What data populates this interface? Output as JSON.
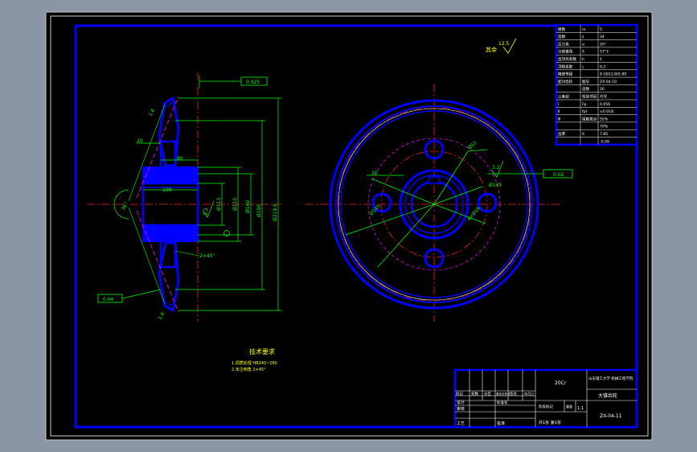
{
  "drawing": {
    "colors": {
      "window_bg": "#8a96a4",
      "paper": "#000000",
      "border": "#0000ff",
      "dimension": "#00ff00",
      "centerline": "#ff2020",
      "hidden": "#ff00ff",
      "text": "#ffffff",
      "note": "#ffff00"
    },
    "section_view": {
      "dims": {
        "bore": "100",
        "hub_len": "80",
        "left_20": "20",
        "tol_top": "0.025",
        "tol_bot": "0.04",
        "dia_113": "Ø113",
        "dia_x": "Ø110",
        "dia_y": "Ø140",
        "dia_z": "Ø190",
        "dia_big": "Ø218.6",
        "chamfer": "2×45°",
        "angle": "36°",
        "tip": "1.6",
        "ra": "3.2"
      }
    },
    "front_view": {
      "dims": {
        "pcd": "Ø145",
        "bolt": "Ø12",
        "bolt_pcd": "Ø145",
        "hole_4": "4×Ø16",
        "ra": "3.2",
        "tol": "0.02",
        "r": "20"
      }
    },
    "roughness_note": {
      "label": "其余",
      "value": "12.5"
    },
    "tech_req": {
      "title": "技术要求",
      "lines": [
        "1.调质处理 HB240~280",
        "2.未注倒角 2×45°"
      ]
    },
    "param_table": {
      "rows": [
        [
          "模数",
          "m",
          "5"
        ],
        [
          "齿数",
          "z",
          "34"
        ],
        [
          "压力角",
          "α",
          "20°"
        ],
        [
          "分度锥角",
          "δ",
          "57°1'"
        ],
        [
          "齿顶高系数",
          "h",
          "1"
        ],
        [
          "顶隙系数",
          "c",
          "0.2"
        ],
        [
          "精度等级",
          "",
          "8 GB11365-89"
        ],
        [
          "配对齿轮",
          "图号",
          "ZX-04-10"
        ],
        [
          "",
          "齿数",
          "26"
        ],
        [
          "公差组",
          "检验项目",
          "代号"
        ],
        [
          "Ⅰ",
          "Fp",
          "0.056"
        ],
        [
          "Ⅱ",
          "fpt",
          "±0.018"
        ],
        [
          "Ⅲ",
          "接触斑点",
          "55%"
        ],
        [
          "",
          "",
          "70%"
        ],
        [
          "齿厚",
          "S",
          "7.85"
        ],
        [
          "",
          "",
          "-0.08"
        ]
      ]
    },
    "title_block": {
      "material": "20Cr",
      "school": "山东理工大学 机械工程学院",
      "part_name": "大锥齿轮",
      "drawing_no": "ZX-04-11",
      "scale": "1:1",
      "sheet": "共1张 第1张",
      "labels": [
        "标记",
        "处数",
        "分区",
        "更改文件号",
        "签名",
        "年月日"
      ],
      "design": "设计",
      "check": "审核",
      "process": "工艺",
      "approve": "批准",
      "std": "标准化",
      "stage": "阶段标记",
      "weight": "重量",
      "ratio": "比例"
    }
  }
}
